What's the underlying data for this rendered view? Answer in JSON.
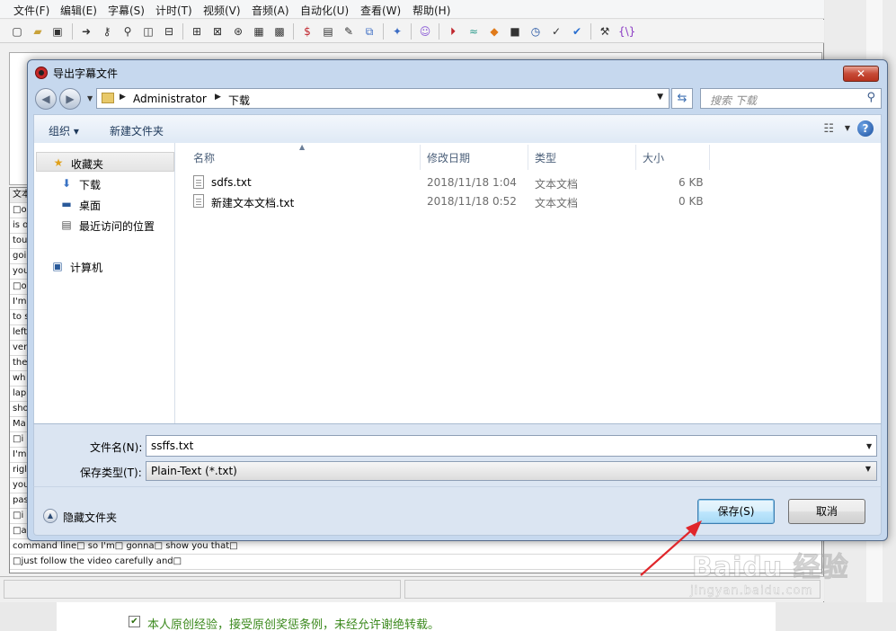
{
  "bg_app": {
    "menu": [
      "文件(F)",
      "编辑(E)",
      "字幕(S)",
      "计时(T)",
      "视频(V)",
      "音频(A)",
      "自动化(U)",
      "查看(W)",
      "帮助(H)"
    ],
    "list_header": "文本",
    "list_rows": [
      "□o",
      "is o",
      "tou",
      "goi",
      "you",
      "□o",
      "I'm",
      "to s",
      "left",
      "ver",
      "the",
      "wh",
      "lap",
      "sho",
      "Ma",
      "□i",
      "I'm",
      "rigl",
      "you",
      "pas",
      "□i",
      "□a",
      "command line□ so I'm□ gonna□ show you that□",
      "□just follow the video carefully and□"
    ]
  },
  "dialog": {
    "title": "导出字幕文件",
    "close_label": "✕",
    "breadcrumbs": [
      "Administrator",
      "下载"
    ],
    "search_placeholder": "搜索 下载",
    "organize_label": "组织 ▾",
    "new_folder_label": "新建文件夹",
    "nav": {
      "favorites": "收藏夹",
      "downloads": "下载",
      "desktop": "桌面",
      "recent": "最近访问的位置",
      "computer": "计算机"
    },
    "columns": [
      "名称",
      "修改日期",
      "类型",
      "大小"
    ],
    "files": [
      {
        "name": "sdfs.txt",
        "date": "2018/11/18 1:04",
        "type": "文本文档",
        "size": "6 KB"
      },
      {
        "name": "新建文本文档.txt",
        "date": "2018/11/18 0:52",
        "type": "文本文档",
        "size": "0 KB"
      }
    ],
    "filename_label": "文件名(N):",
    "filename_value": "ssffs.txt",
    "filetype_label": "保存类型(T):",
    "filetype_value": "Plain-Text (*.txt)",
    "hide_folders_label": "隐藏文件夹",
    "save_label": "保存(S)",
    "cancel_label": "取消"
  },
  "page_footer": {
    "original_checked": true,
    "original_text": "本人原创经验，接受原创奖惩条例，未经允许谢绝转载。"
  },
  "watermark": {
    "logo": "Baidu 经验",
    "url": "jingyan.baidu.com"
  },
  "colors": {
    "dialog_frame": "#c6d8ee",
    "close_button": "#c74a36",
    "save_button_border": "#3c7fb1",
    "footer_text": "#3c8a1e",
    "annotation_arrow": "#e0262b"
  }
}
